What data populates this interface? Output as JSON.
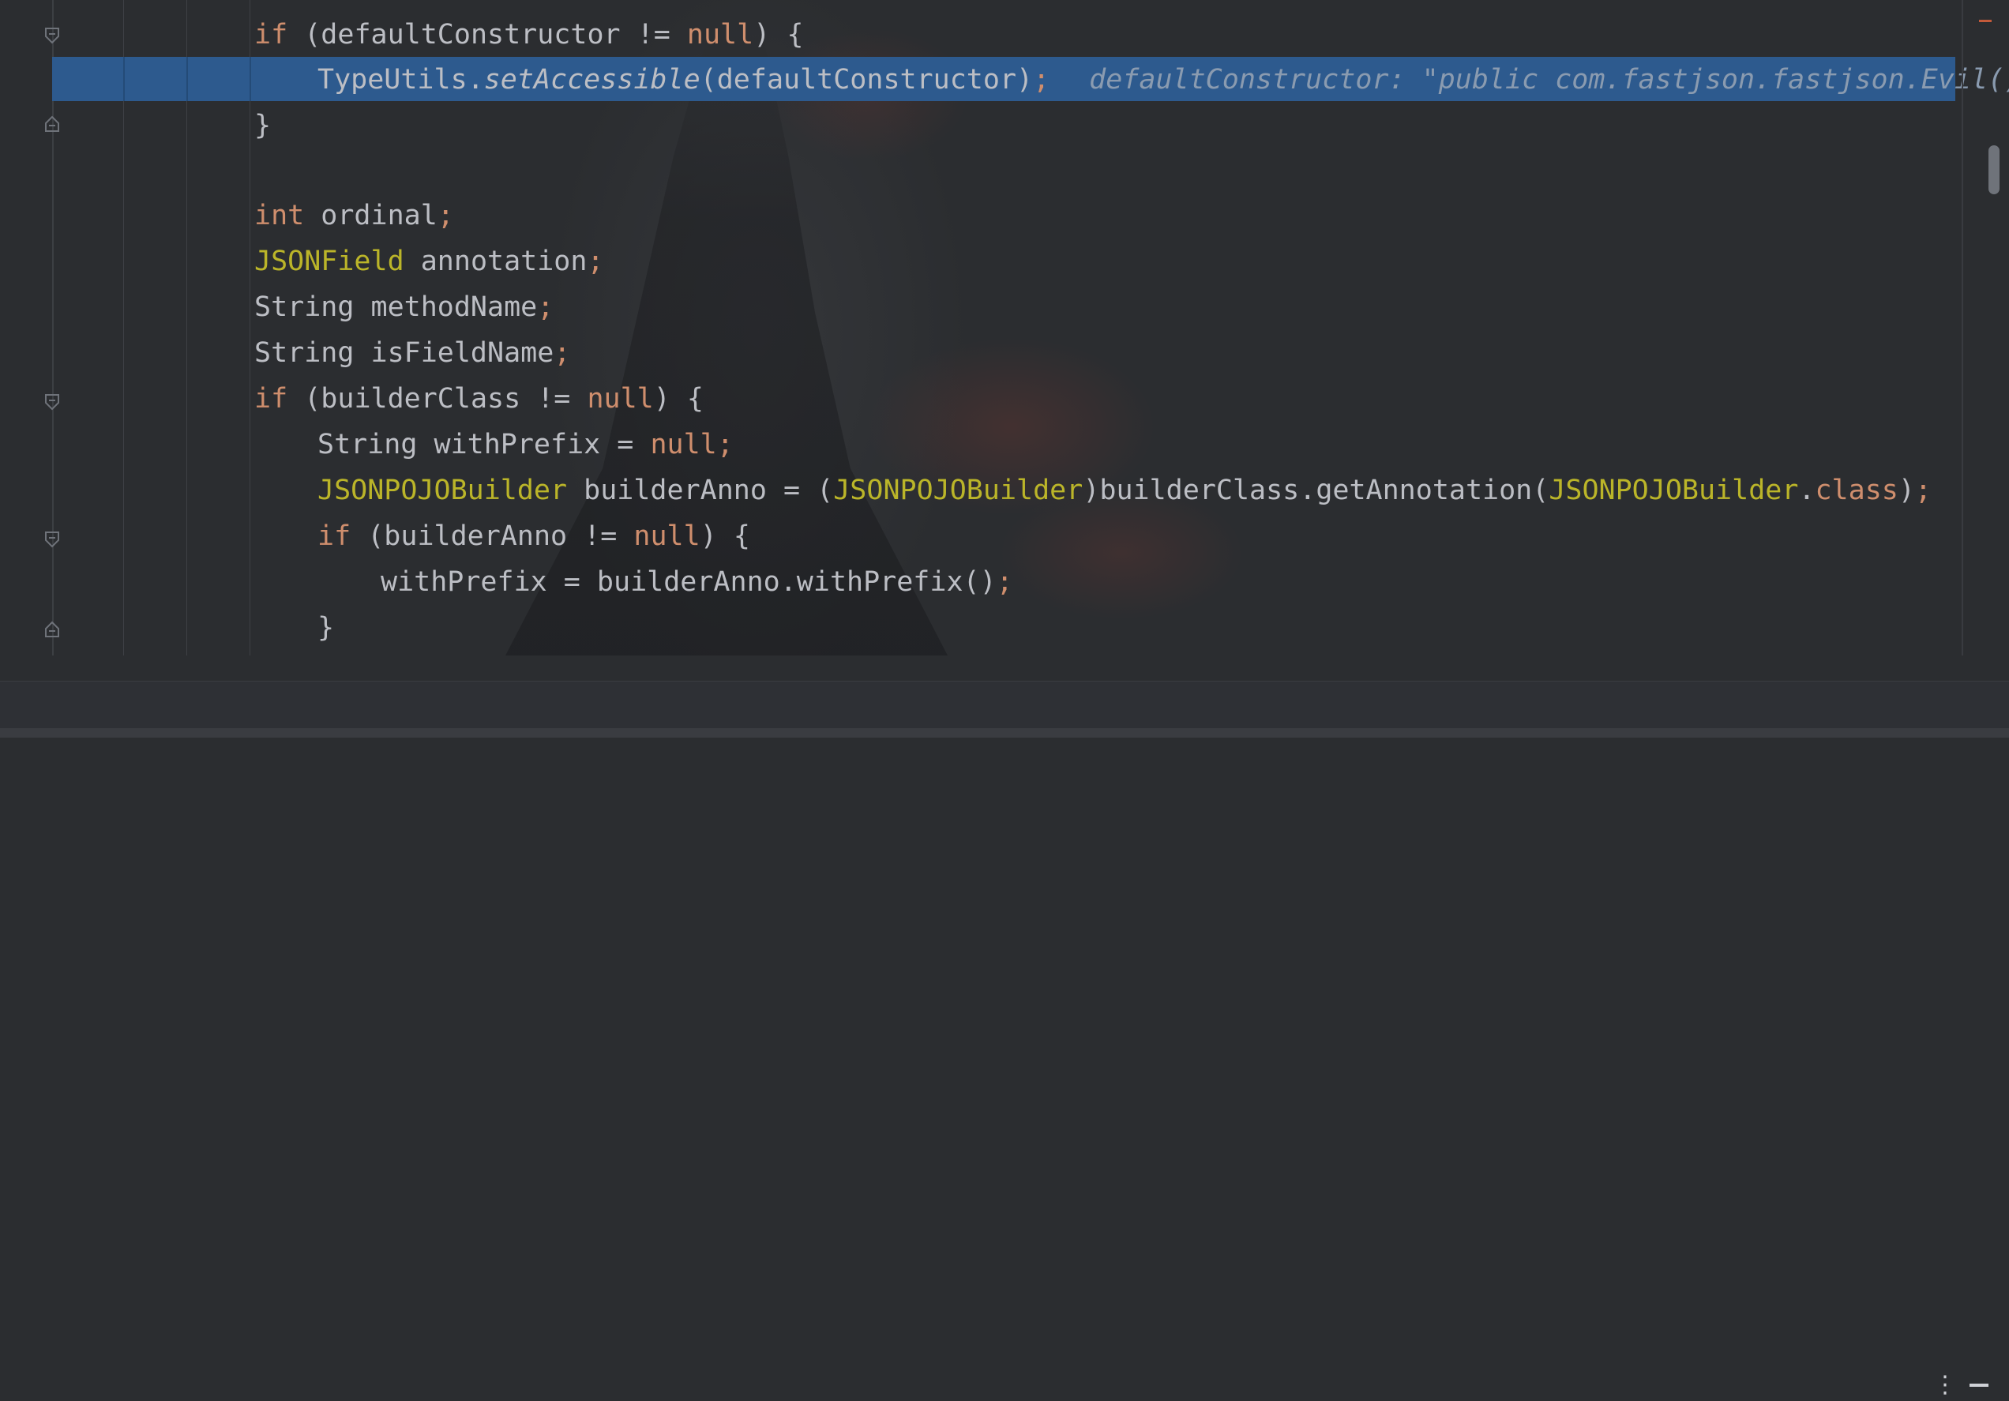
{
  "editor": {
    "lines": [
      {
        "parts": [
          {
            "t": "if",
            "c": "kw"
          },
          {
            "t": " (defaultConstructor != "
          },
          {
            "t": "null",
            "c": "kw"
          },
          {
            "t": ") {"
          }
        ]
      },
      {
        "parts": [
          {
            "t": "TypeUtils."
          },
          {
            "t": "setAccessible",
            "c": "it"
          },
          {
            "t": "(defaultConstructor)"
          },
          {
            "t": ";",
            "c": "semi"
          }
        ],
        "hint": "defaultConstructor: \"public com.fastjson.fastjson.Evil()\""
      },
      {
        "parts": [
          {
            "t": "}"
          }
        ]
      },
      {
        "parts": []
      },
      {
        "parts": [
          {
            "t": "int",
            "c": "kw"
          },
          {
            "t": " ordinal"
          },
          {
            "t": ";",
            "c": "semi"
          }
        ]
      },
      {
        "parts": [
          {
            "t": "JSONField",
            "c": "typ"
          },
          {
            "t": " annotation"
          },
          {
            "t": ";",
            "c": "semi"
          }
        ]
      },
      {
        "parts": [
          {
            "t": "String methodName"
          },
          {
            "t": ";",
            "c": "semi"
          }
        ]
      },
      {
        "parts": [
          {
            "t": "String isFieldName"
          },
          {
            "t": ";",
            "c": "semi"
          }
        ]
      },
      {
        "parts": [
          {
            "t": "if",
            "c": "kw"
          },
          {
            "t": " (builderClass != "
          },
          {
            "t": "null",
            "c": "kw"
          },
          {
            "t": ") {"
          }
        ]
      },
      {
        "parts": [
          {
            "t": "String withPrefix = "
          },
          {
            "t": "null",
            "c": "kw"
          },
          {
            "t": ";",
            "c": "semi"
          }
        ]
      },
      {
        "parts": [
          {
            "t": "JSONPOJOBuilder",
            "c": "typ"
          },
          {
            "t": " builderAnno = ("
          },
          {
            "t": "JSONPOJOBuilder",
            "c": "typ"
          },
          {
            "t": ")builderClass.getAnnotation("
          },
          {
            "t": "JSONPOJOBuilder",
            "c": "typ"
          },
          {
            "t": "."
          },
          {
            "t": "class",
            "c": "kw"
          },
          {
            "t": ")"
          },
          {
            "t": ";",
            "c": "semi"
          }
        ]
      },
      {
        "parts": [
          {
            "t": "if",
            "c": "kw"
          },
          {
            "t": " (builderAnno != "
          },
          {
            "t": "null",
            "c": "kw"
          },
          {
            "t": ") {"
          }
        ]
      },
      {
        "parts": [
          {
            "t": "withPrefix = builderAnno.withPrefix()"
          },
          {
            "t": ";",
            "c": "semi"
          }
        ]
      },
      {
        "parts": [
          {
            "t": "}"
          }
        ]
      }
    ]
  },
  "status_bar": {
    "more_icon": "more-vertical-icon",
    "minimize_icon": "minimize-icon"
  },
  "colors": {
    "background": "#2b2d30",
    "execution_highlight": "#2d5a8e",
    "keyword": "#cf8e6d",
    "type": "#bbb529",
    "text": "#bcbec4",
    "inlay_hint": "#8a9bb0"
  }
}
